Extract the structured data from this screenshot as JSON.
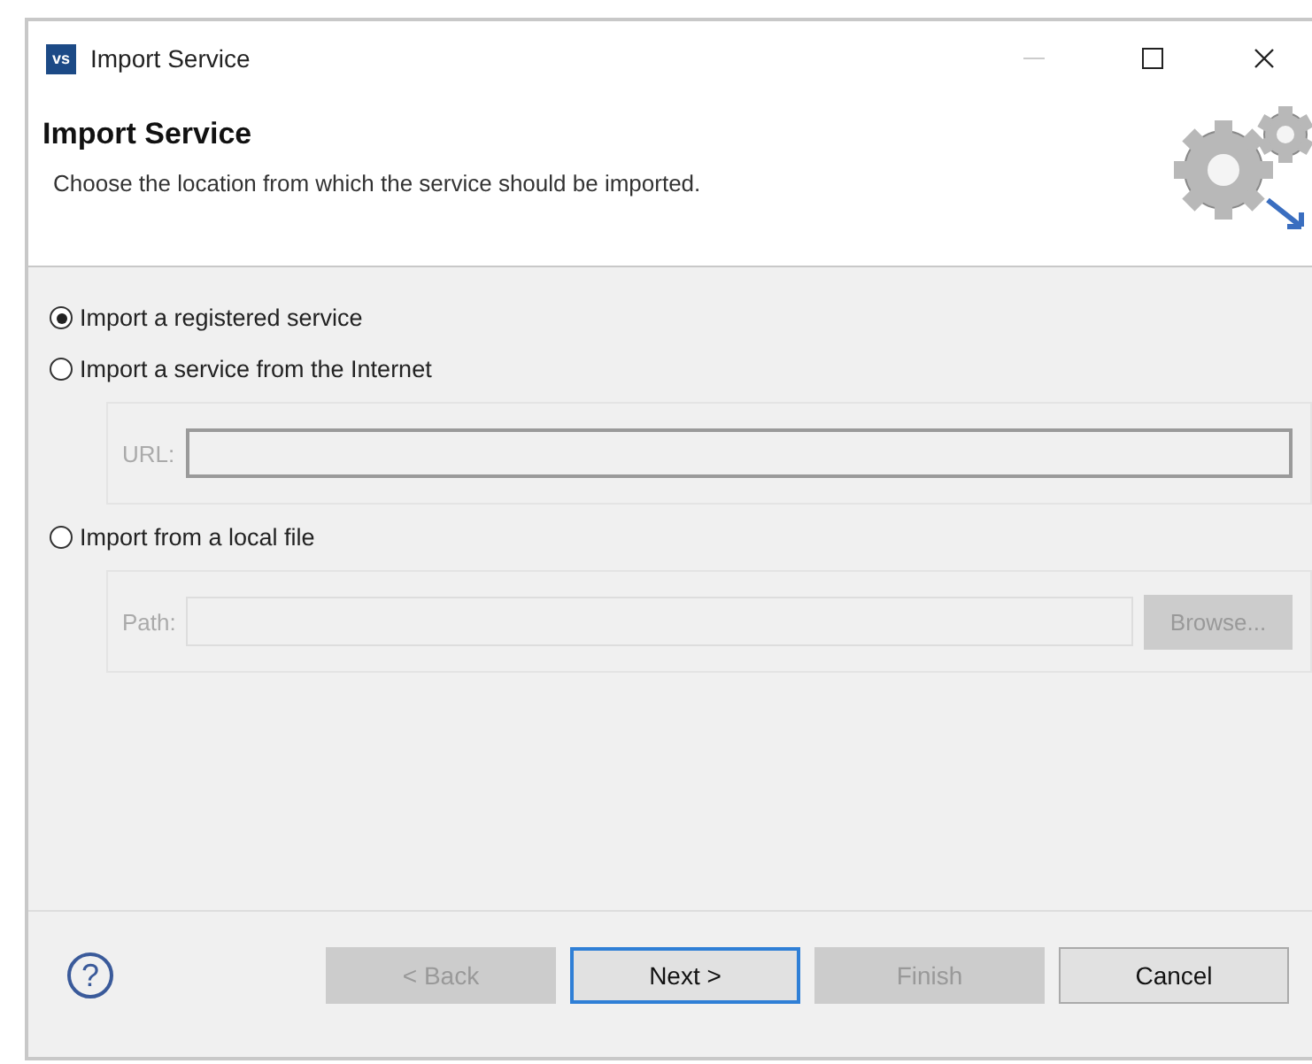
{
  "window": {
    "title": "Import Service",
    "app_badge": "vs"
  },
  "header": {
    "title": "Import Service",
    "description": "Choose the location from which the service should be imported."
  },
  "options": [
    {
      "label": "Import a registered service",
      "selected": true
    },
    {
      "label": "Import a service from the Internet",
      "selected": false,
      "field": {
        "label": "URL:",
        "disabled": true
      }
    },
    {
      "label": "Import from a local file",
      "selected": false,
      "field": {
        "label": "Path:",
        "disabled": true,
        "button": {
          "label": "Browse...",
          "disabled": true
        }
      }
    }
  ],
  "help": "?",
  "buttons": [
    {
      "label": "< Back",
      "disabled": true,
      "default": false
    },
    {
      "label": "Next >",
      "disabled": false,
      "default": true
    },
    {
      "label": "Finish",
      "disabled": true,
      "default": false
    },
    {
      "label": "Cancel",
      "disabled": false,
      "default": false
    }
  ]
}
